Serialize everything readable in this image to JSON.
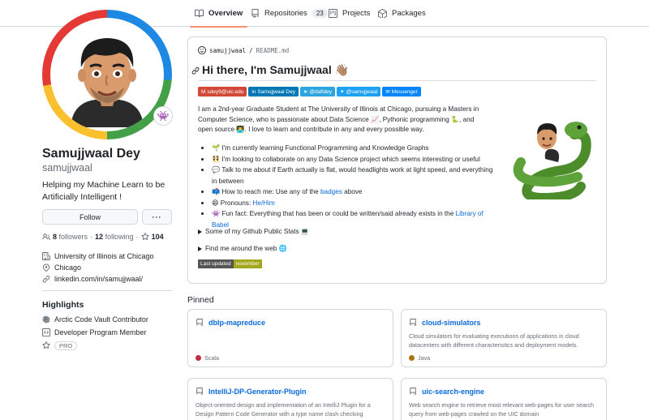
{
  "tabs": [
    {
      "label": "Overview",
      "active": true,
      "icon": "book-icon"
    },
    {
      "label": "Repositories",
      "count": "23",
      "icon": "repo-icon"
    },
    {
      "label": "Projects",
      "icon": "project-icon"
    },
    {
      "label": "Packages",
      "icon": "package-icon"
    }
  ],
  "profile": {
    "name": "Samujjwaal Dey",
    "login": "samujjwaal",
    "bio": "Helping my Machine Learn to be Artificially Intelligent !",
    "follow_label": "Follow",
    "more_label": "···",
    "followers_count": "8",
    "followers_label": "followers",
    "separator": "·",
    "following_count": "12",
    "following_label": "following",
    "stars_count": "104",
    "organization": "University of Illinois at Chicago",
    "location": "Chicago",
    "linkedin": "linkedin.com/in/samujjwaal/",
    "status_icon": "alien-monster-icon"
  },
  "highlights": {
    "title": "Highlights",
    "items": [
      {
        "label": "Arctic Code Vault Contributor",
        "icon": "snowflake-icon"
      },
      {
        "label": "Developer Program Member",
        "icon": "code-square-icon"
      },
      {
        "label": "PRO",
        "icon": "star-icon"
      }
    ]
  },
  "readme": {
    "owner": "samujjwaal",
    "slash": "/",
    "file": "README.md",
    "heading": "Hi there, I'm Samujjwaal 👋🏽",
    "badges": [
      {
        "label": "sdey9@uic.edu",
        "color": "#d14836",
        "icon": "gmail-icon"
      },
      {
        "label": "Samujjwaal Dey",
        "color": "#0077b5",
        "icon": "linkedin-icon"
      },
      {
        "label": "@dafidey",
        "color": "#2ca5e0",
        "icon": "telegram-icon"
      },
      {
        "label": "@samujjwaal",
        "color": "#1da1f2",
        "icon": "twitter-icon"
      },
      {
        "label": "Messenger",
        "color": "#0084ff",
        "icon": "messenger-icon"
      }
    ],
    "intro": {
      "part1": "I am a 2nd-year Graduate Student at The University of Illinois at Chicago, pursuing a Masters in Computer Science, who is passionate about Data Science 📈, Pythonic programming 🐍, and open source 👨‍💻. I love to learn and contribute in any and every possible way."
    },
    "bullets": [
      {
        "text": "🌱 I'm currently learning Functional Programming and Knowledge Graphs"
      },
      {
        "text": "👯 I'm looking to collaborate on any Data Science project which seems interesting or useful"
      },
      {
        "text": "💬 Talk to me about if Earth actually is flat, would headlights work at light speed, and everything in between"
      },
      {
        "pre": "📫 How to reach me: Use any of the ",
        "link": "badges",
        "post": " above"
      },
      {
        "pre": "😄 Pronouns: ",
        "link": "He/Him",
        "post": ""
      },
      {
        "pre": "👾 Fun fact: Everything that has been or could be written/said already exists in the ",
        "link": "Library of Babel",
        "post": ""
      }
    ],
    "stats_summary": "Some of my Github Public Stats 💻",
    "web_summary": "Find me around the web 🌐",
    "updated_label": "Last updated",
    "updated_value": "november",
    "updated_colors": {
      "label": "#555555",
      "value": "#a4a61d"
    }
  },
  "pinned": {
    "title": "Pinned",
    "repos": [
      {
        "name": "dblp-mapreduce",
        "description": "",
        "language": "Scala",
        "color": "#c22d40"
      },
      {
        "name": "cloud-simulators",
        "description": "Cloud simulators for evaluating executions of applications in cloud datacenters with different characteristics and deployment models.",
        "language": "Java",
        "color": "#b07219"
      },
      {
        "name": "IntelliJ-DP-Generator-Plugin",
        "description": "Object-oriented design and implementation of an IntelliJ Plugin for a Design Pattern Code Generator with a type name clash checking functionality",
        "language": "",
        "color": ""
      },
      {
        "name": "uic-search-engine",
        "description": "Web search engine to retrieve most relevant web-pages for user search query from web-pages crawled on the UIC domain",
        "language": "",
        "color": ""
      }
    ]
  }
}
